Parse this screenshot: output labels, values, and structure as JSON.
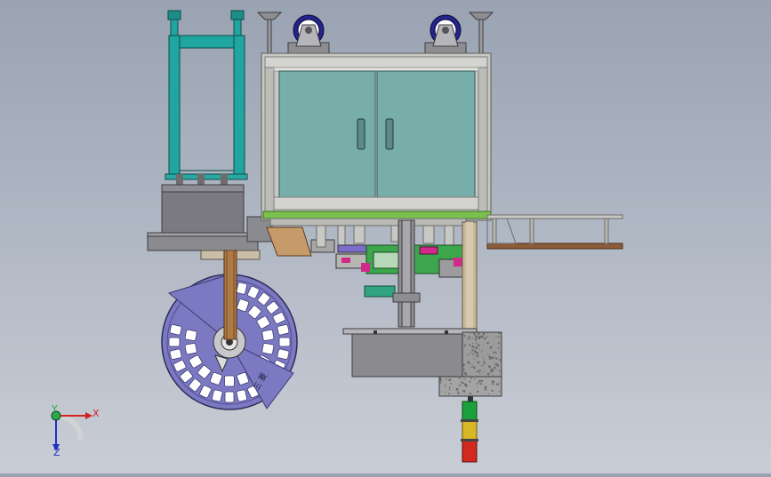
{
  "triad": {
    "x_label": "X",
    "y_label": "Y",
    "z_label": "Z"
  },
  "wheel": {
    "engraving": "三 菱"
  },
  "colors": {
    "frame_teal": "#1fa6a0",
    "cabinet_glass": "#78aeaa",
    "aluminum_frame": "#c8c8c4",
    "wheel_blue": "#7b79c2",
    "tower_red": "#d2291f",
    "tower_yellow": "#d8b726",
    "tower_green": "#1aa13c",
    "pcb_green": "#3ca64d"
  }
}
